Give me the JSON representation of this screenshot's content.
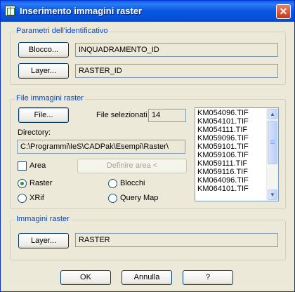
{
  "window": {
    "title": "Inserimento immagini raster",
    "close_glyph": "✕"
  },
  "group_id": {
    "label": "Parametri dell'identificativo",
    "block_button": "Blocco...",
    "block_value": "INQUADRAMENTO_ID",
    "layer_button": "Layer...",
    "layer_value": "RASTER_ID"
  },
  "group_files": {
    "label": "File immagini raster",
    "file_button": "File...",
    "selected_label": "File selezionati",
    "selected_count": "14",
    "directory_label": "Directory:",
    "directory_value": "C:\\Programmi\\IeS\\CADPak\\Esempi\\Raster\\",
    "area_label": "Area",
    "area_checked": false,
    "define_area_button": "Definire area <",
    "radios": {
      "raster": "Raster",
      "blocchi": "Blocchi",
      "xrif": "XRif",
      "query_map": "Query Map",
      "selected": "raster"
    },
    "files": [
      "KM054096.TIF",
      "KM054101.TIF",
      "KM054111.TIF",
      "KM059096.TIF",
      "KM059101.TIF",
      "KM059106.TIF",
      "KM059111.TIF",
      "KM059116.TIF",
      "KM064096.TIF",
      "KM064101.TIF"
    ],
    "scroll_up_icon": "▲",
    "scroll_down_icon": "▼"
  },
  "group_raster": {
    "label": "Immagini raster",
    "layer_button": "Layer...",
    "layer_value": "RASTER"
  },
  "buttons": {
    "ok": "OK",
    "cancel": "Annulla",
    "help": "?"
  }
}
